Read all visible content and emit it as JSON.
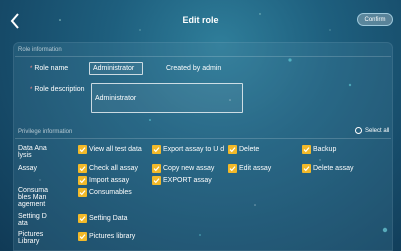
{
  "header": {
    "title": "Edit role",
    "confirm_label": "Confirm"
  },
  "role_info": {
    "section_title": "Role information",
    "name_label": "Role name",
    "name_value": "Administrator",
    "created_by_label": "Created by",
    "created_by_value": "admin",
    "description_label": "Role description",
    "description_value": "Administrator"
  },
  "privilege_info": {
    "section_title": "Privilege information",
    "select_all_label": "Select all",
    "categories": [
      {
        "label": "Data Analysis",
        "permissions": [
          "View all test data",
          "Export assay to U d",
          "Delete",
          "Backup"
        ]
      },
      {
        "label": "Assay",
        "permissions": [
          "Check all assay",
          "Copy new assay",
          "Edit assay",
          "Delete assay",
          "Import assay",
          "EXPORT assay"
        ]
      },
      {
        "label": "Consumables Management",
        "permissions": [
          "Consumables"
        ]
      },
      {
        "label": "Setting Data",
        "permissions": [
          "Setting Data"
        ]
      },
      {
        "label": "Pictures Library",
        "permissions": [
          "Pictures library"
        ]
      }
    ]
  },
  "colors": {
    "checkbox": "#f2b929",
    "background": "#1e5f7e"
  },
  "icons": {
    "back": "chevron-left-icon",
    "checkbox": "check-icon",
    "select_all": "radio-icon"
  }
}
